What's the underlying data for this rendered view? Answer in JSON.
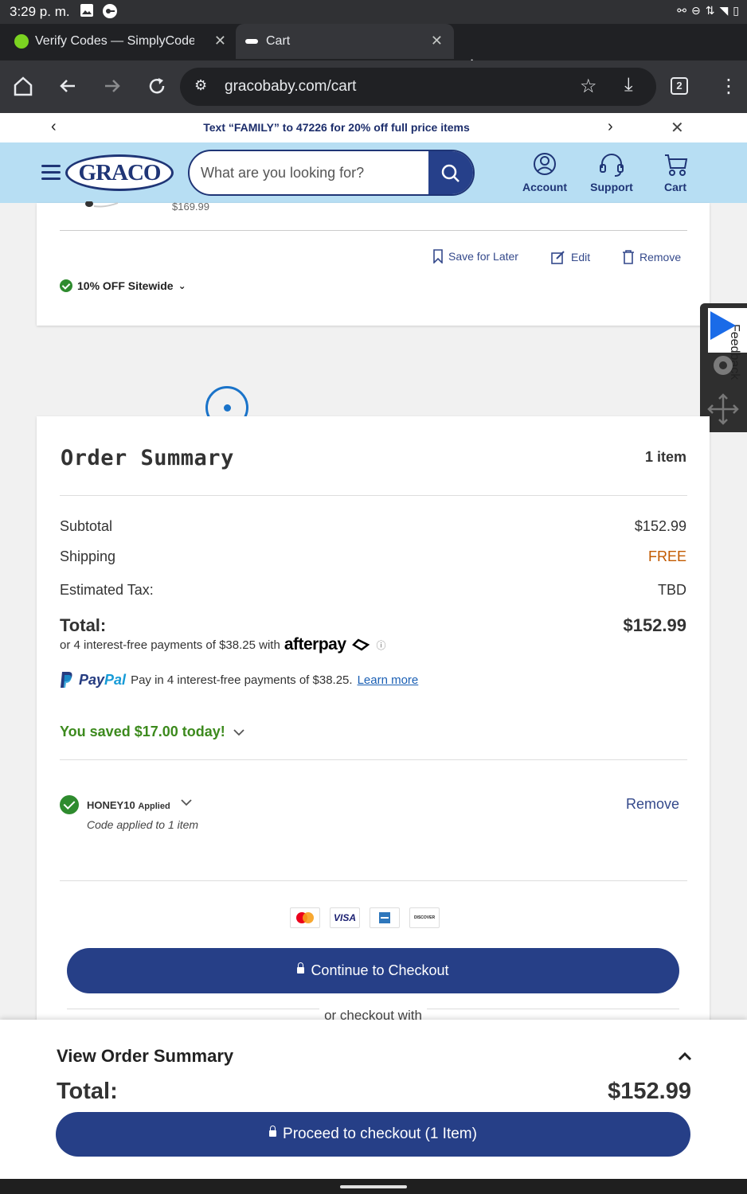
{
  "status_bar": {
    "time": "3:29 p. m."
  },
  "browser": {
    "tabs": [
      {
        "title": "Verify Codes — SimplyCodes",
        "active": false
      },
      {
        "title": "Cart",
        "active": true
      }
    ],
    "url": "gracobaby.com/cart",
    "tab_count": "2"
  },
  "promo_banner": {
    "text": "Text “FAMILY” to 47226 for 20% off full price items"
  },
  "header": {
    "logo": "GRACO",
    "search_placeholder": "What are you looking for?",
    "nav": [
      {
        "label": "Account",
        "icon": "user-circle-icon"
      },
      {
        "label": "Support",
        "icon": "headset-icon"
      },
      {
        "label": "Cart",
        "icon": "cart-icon"
      }
    ]
  },
  "cart_item": {
    "original_price": "$169.99",
    "actions": {
      "save": "Save for Later",
      "edit": "Edit",
      "remove": "Remove"
    },
    "promotion": "10% OFF Sitewide"
  },
  "feedback_widget": {
    "label": "Feedback"
  },
  "order_summary": {
    "title": "Order Summary",
    "item_count": "1 item",
    "subtotal_label": "Subtotal",
    "subtotal_value": "$152.99",
    "shipping_label": "Shipping",
    "shipping_value": "FREE",
    "tax_label": "Estimated Tax:",
    "tax_value": "TBD",
    "total_label": "Total:",
    "total_value": "$152.99",
    "afterpay_text": "or 4 interest-free payments of $38.25 with",
    "afterpay_logo": "afterpay",
    "paypal_logo_a": "Pay",
    "paypal_logo_b": "Pal",
    "paypal_text": "Pay in 4 interest-free payments of $38.25.",
    "paypal_link": "Learn more",
    "saved_text": "You saved $17.00 today!",
    "coupon_code": "HONEY10",
    "coupon_status": "Applied",
    "coupon_note": "Code applied to 1 item",
    "coupon_remove": "Remove",
    "payment_cards": [
      "mastercard",
      "VISA",
      "amex",
      "DISCOVER"
    ],
    "checkout_button": "Continue to Checkout",
    "alt_checkout": "or checkout with"
  },
  "sticky_footer": {
    "title": "View Order Summary",
    "total_label": "Total:",
    "total_value": "$152.99",
    "button": "Proceed to checkout (1 Item)"
  },
  "colors": {
    "brand_navy": "#263f87",
    "header_bg": "#b7def3",
    "success_green": "#3c8a1d",
    "free_orange": "#c25a00"
  }
}
